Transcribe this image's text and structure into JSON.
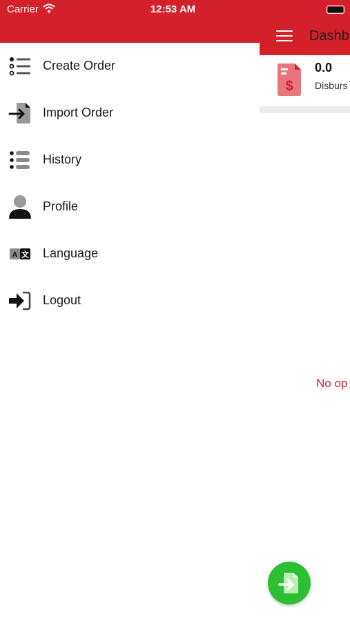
{
  "status_bar": {
    "carrier": "Carrier",
    "time": "12:53 AM"
  },
  "header": {
    "title": "Dashb",
    "menu_icon": "hamburger-icon",
    "color": "#d4202a"
  },
  "summary_card": {
    "value": "0.0",
    "label": "Disburs",
    "icon": "money-document-icon",
    "icon_color": "#e8777d"
  },
  "empty_state": {
    "message": "No op"
  },
  "fab": {
    "icon": "import-document-icon",
    "color": "#2dbf33"
  },
  "drawer": {
    "items": [
      {
        "label": "Create Order",
        "icon": "list-icon"
      },
      {
        "label": "Import Order",
        "icon": "import-file-icon"
      },
      {
        "label": "History",
        "icon": "history-list-icon"
      },
      {
        "label": "Profile",
        "icon": "person-icon"
      },
      {
        "label": "Language",
        "icon": "language-icon"
      },
      {
        "label": "Logout",
        "icon": "logout-icon"
      }
    ]
  }
}
